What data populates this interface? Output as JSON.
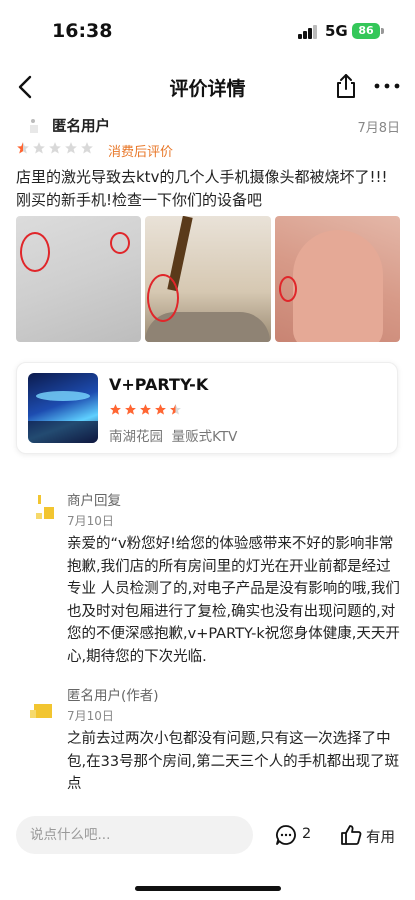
{
  "status_bar": {
    "time": "16:38",
    "network": "5G",
    "battery": "86"
  },
  "nav": {
    "title": "评价详情"
  },
  "review": {
    "user": "匿名用户",
    "date": "7月8日",
    "rating": 1,
    "tag": "消费后评价",
    "text": "店里的激光导致去ktv的几个人手机摄像头都被烧坏了!!!刚买的新手机!检查一下你们的设备吧",
    "photo_count": 3
  },
  "shop": {
    "name": "V+PARTY-K",
    "rating": 4.5,
    "area": "南湖花园",
    "category": "量贩式KTV"
  },
  "replies": [
    {
      "name": "商户回复",
      "date": "7月10日",
      "text": "亲爱的“v粉您好!给您的体验感带来不好的影响非常抱歉,我们店的所有房间里的灯光在开业前都是经过专业 人员检测了的,对电子产品是没有影响的哦,我们也及时对包厢进行了复检,确实也没有出现问题的,对您的不便深感抱歉,v+PARTY-k祝您身体健康,天天开心,期待您的下次光临."
    },
    {
      "name": "匿名用户(作者)",
      "date": "7月10日",
      "text": "之前去过两次小包都没有问题,只有这一次选择了中包,在33号那个房间,第二天三个人的手机都出现了斑点"
    }
  ],
  "bottom_bar": {
    "comment_placeholder": "说点什么吧...",
    "comment_count": "2",
    "useful_label": "有用"
  },
  "colors": {
    "accent": "#ff6633",
    "tag": "#e8782a",
    "star_off": "#d9d9d9"
  }
}
